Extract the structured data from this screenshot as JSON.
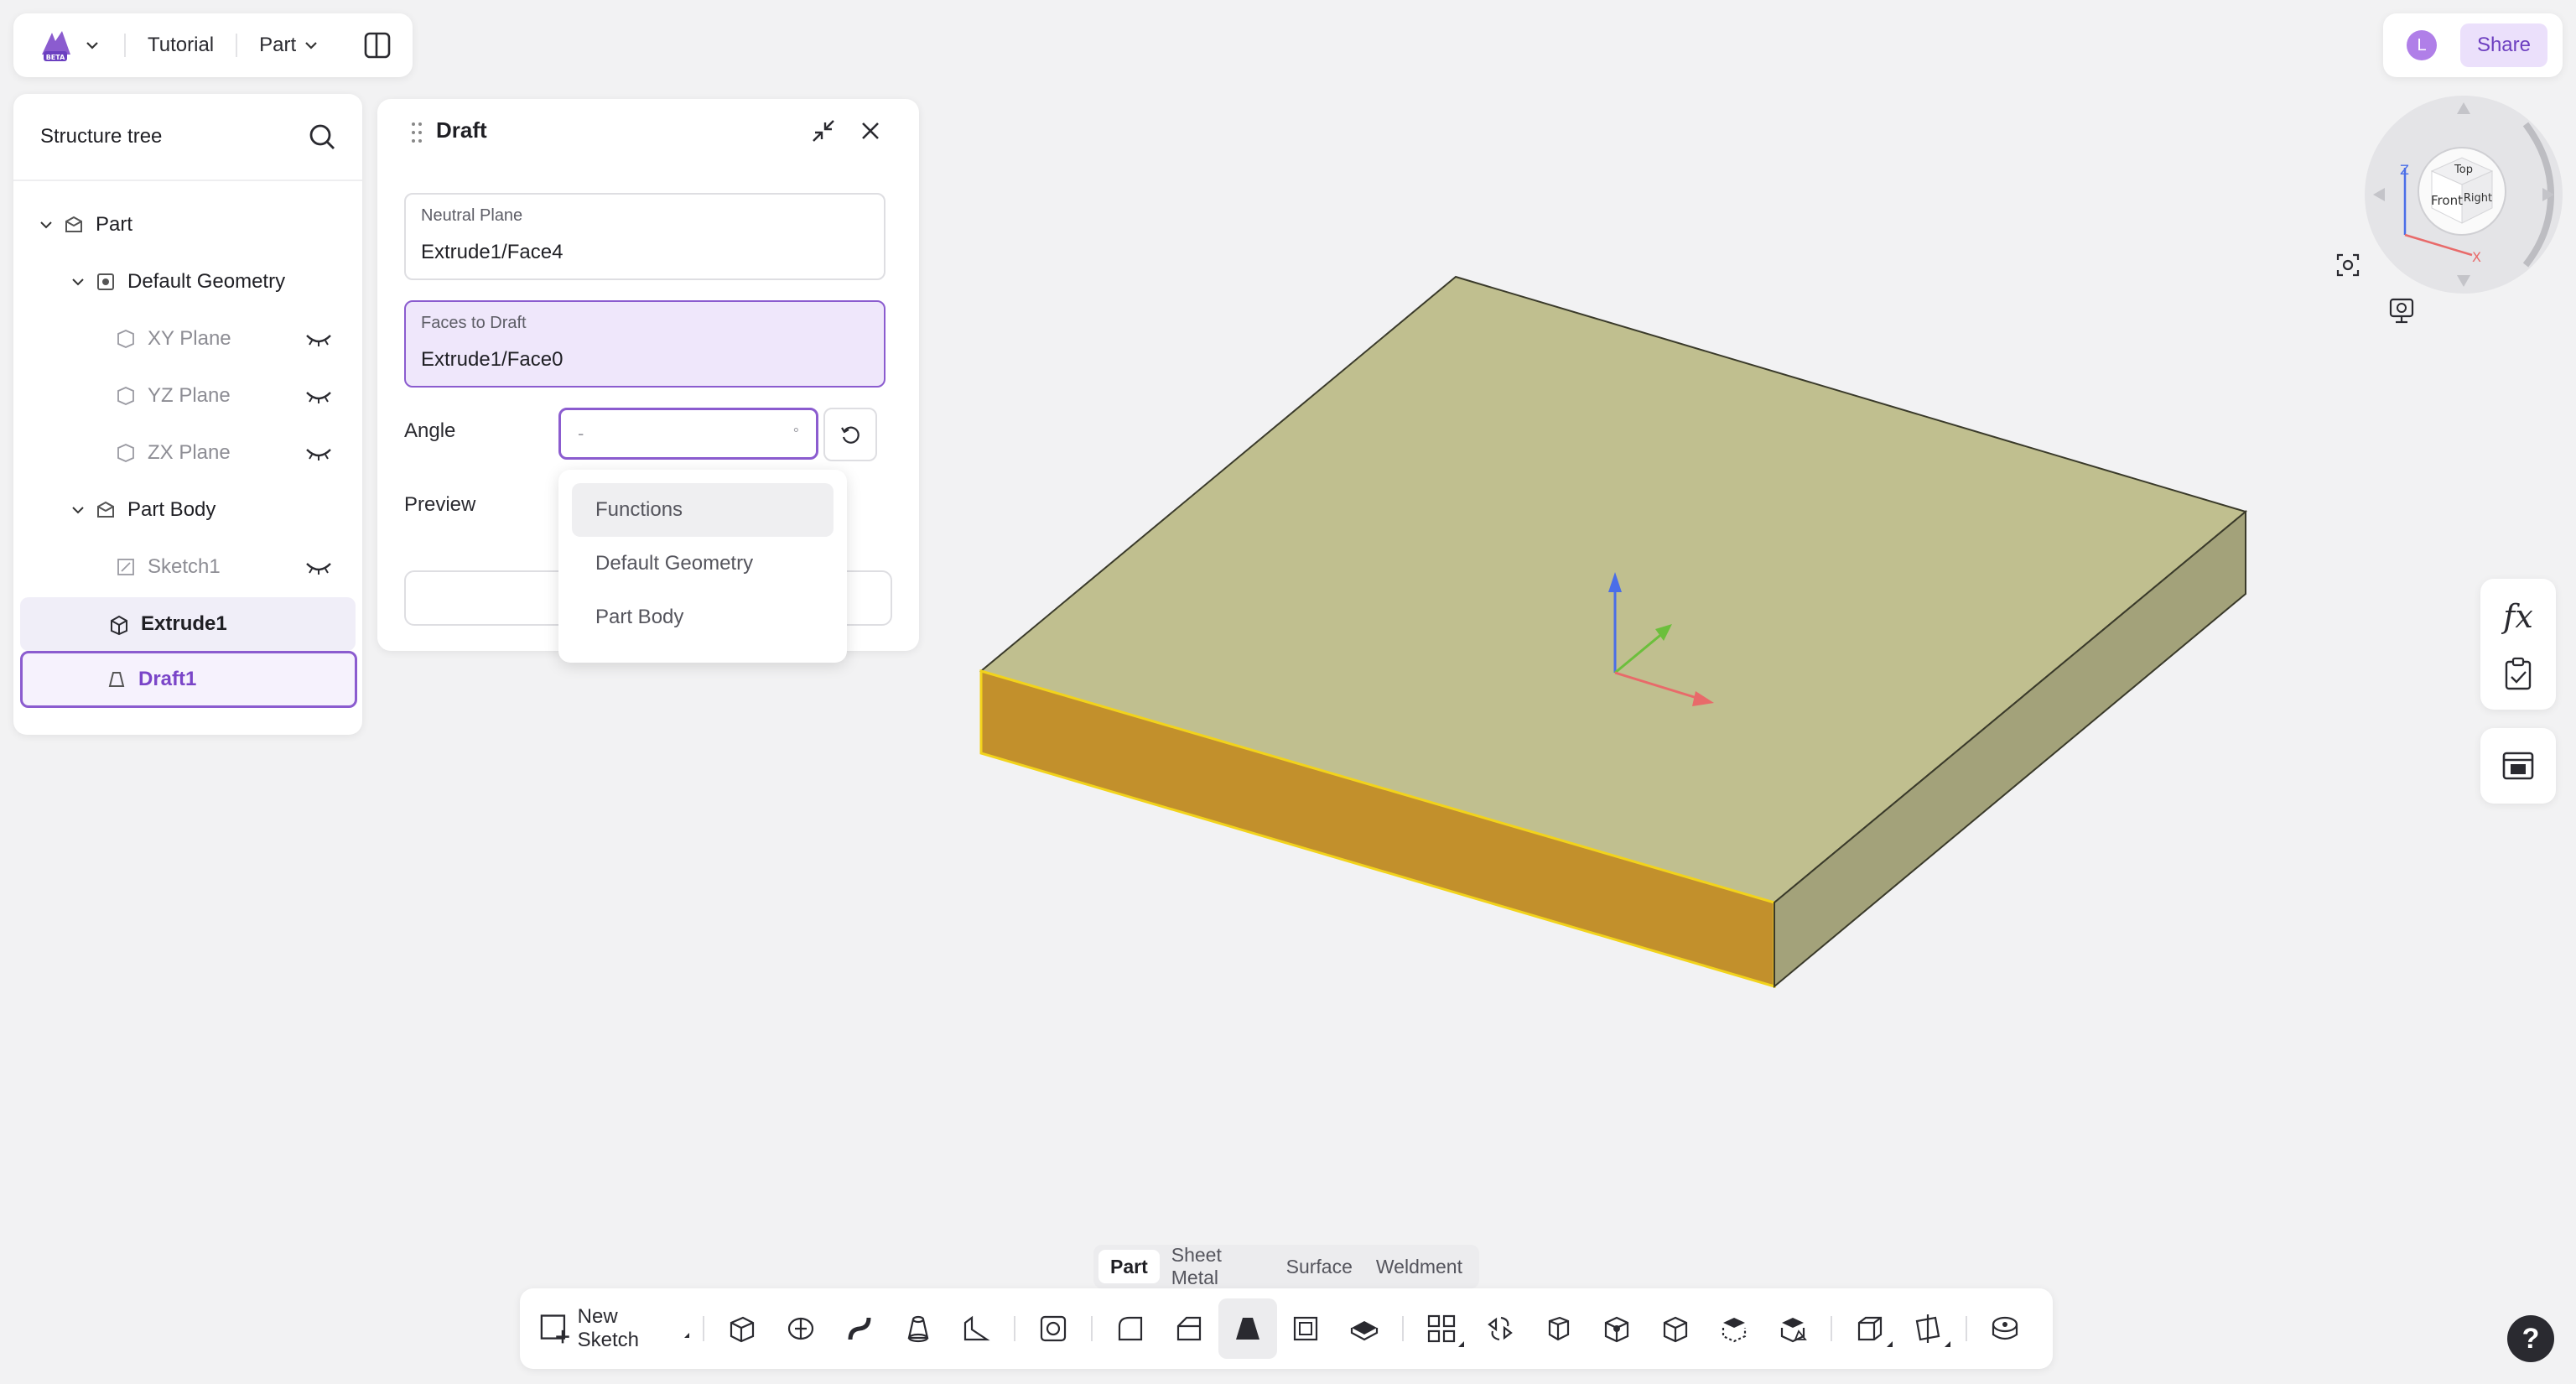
{
  "app": {
    "project": "Tutorial",
    "document": "Part"
  },
  "tree": {
    "title": "Structure tree",
    "items": [
      {
        "label": "Part"
      },
      {
        "label": "Default Geometry"
      },
      {
        "label": "XY Plane"
      },
      {
        "label": "YZ Plane"
      },
      {
        "label": "ZX Plane"
      },
      {
        "label": "Part Body"
      },
      {
        "label": "Sketch1"
      },
      {
        "label": "Extrude1"
      },
      {
        "label": "Draft1"
      }
    ]
  },
  "draft": {
    "title": "Draft",
    "neutral_plane": {
      "caption": "Neutral Plane",
      "value": "Extrude1/Face4"
    },
    "faces_to_draft": {
      "caption": "Faces to Draft",
      "value": "Extrude1/Face0"
    },
    "angle": {
      "label": "Angle",
      "value": "-",
      "unit": "°"
    },
    "preview_label": "Preview"
  },
  "dropdown": {
    "options": [
      "Functions",
      "Default Geometry",
      "Part Body"
    ],
    "highlighted": "Functions"
  },
  "header_right": {
    "avatar_initial": "L",
    "share_label": "Share"
  },
  "viewcube": {
    "faces": {
      "top": "Top",
      "front": "Front",
      "right": "Right"
    },
    "axes": {
      "x": "X",
      "z": "Z"
    }
  },
  "side_tools": {
    "fx_label": "fx"
  },
  "mode_tabs": {
    "tabs": [
      "Part",
      "Sheet Metal",
      "Surface",
      "Weldment"
    ],
    "active": "Part"
  },
  "toolbar": {
    "new_sketch_label": "New Sketch",
    "tools": [
      "extrude-icon",
      "revolve-icon",
      "sweep-icon",
      "loft-icon",
      "rib-icon",
      "hole-icon",
      "fillet-icon",
      "chamfer-icon",
      "draft-icon",
      "shell-icon",
      "thicken-icon",
      "pattern-icon",
      "mirror-icon",
      "move-body-icon",
      "boolean-icon",
      "box-icon",
      "split-icon",
      "section-icon",
      "view-mode-icon",
      "reference-plane-icon",
      "measure-icon"
    ]
  },
  "help": {
    "label": "?"
  },
  "colors": {
    "accent": "#8b5ccf",
    "accent_bg": "#efe7fb",
    "part_top": "#c0bf8f",
    "part_front": "#c2902c",
    "part_side": "#a3a27a",
    "background": "#f2f2f3"
  }
}
